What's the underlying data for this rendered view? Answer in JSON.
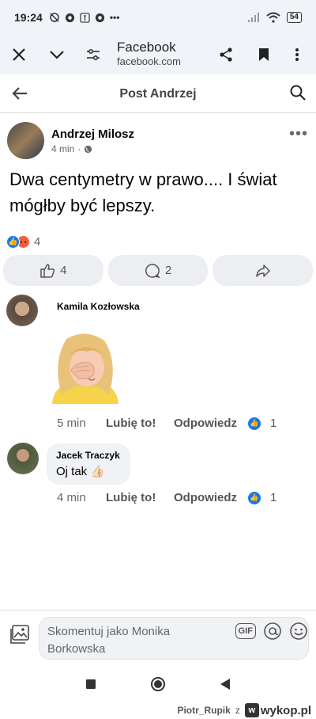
{
  "status_bar": {
    "time": "19:24",
    "battery": "54",
    "icons": [
      "silent-icon",
      "chrome-icon",
      "accessibility-icon",
      "chrome-icon",
      "more-dots-icon"
    ]
  },
  "browser": {
    "site_title": "Facebook",
    "site_url": "facebook.com"
  },
  "fb_header": {
    "title": "Post Andrzej"
  },
  "post": {
    "author": "Andrzej Milosz",
    "time": "4 min",
    "separator": "·",
    "text": "Dwa centymetry w prawo.... I świat mógłby być lepszy.",
    "reaction_count": "4",
    "like_count": "4",
    "comment_count": "2"
  },
  "comments": [
    {
      "author": "Kamila Kozłowska",
      "time": "5 min",
      "like_label": "Lubię to!",
      "reply_label": "Odpowiedz",
      "likes": "1"
    },
    {
      "author": "Jacek Traczyk",
      "text": "Oj tak 👍🏻",
      "time": "4 min",
      "like_label": "Lubię to!",
      "reply_label": "Odpowiedz",
      "likes": "1"
    }
  ],
  "composer": {
    "placeholder": "Skomentuj jako Monika Borkowska",
    "gif_label": "GIF"
  },
  "watermark": {
    "user": "Piotr_Rupik",
    "z": "z",
    "site": "wykop.pl",
    "logo_letter": "w"
  },
  "colors": {
    "fb_blue": "#1877f2",
    "angry": "#f0603c",
    "bubble": "#f0f2f5"
  }
}
